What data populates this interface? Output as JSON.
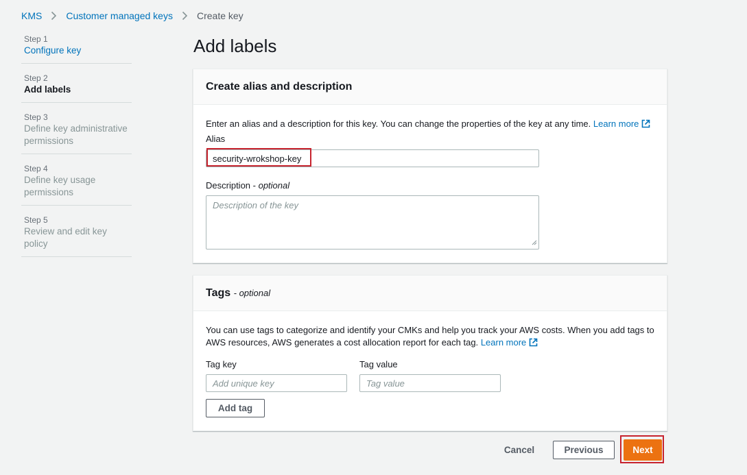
{
  "breadcrumb": {
    "items": [
      "KMS",
      "Customer managed keys"
    ],
    "current": "Create key"
  },
  "steps": [
    {
      "num": "Step 1",
      "label": "Configure key",
      "state": "done"
    },
    {
      "num": "Step 2",
      "label": "Add labels",
      "state": "active"
    },
    {
      "num": "Step 3",
      "label": "Define key administrative permissions",
      "state": "pending"
    },
    {
      "num": "Step 4",
      "label": "Define key usage permissions",
      "state": "pending"
    },
    {
      "num": "Step 5",
      "label": "Review and edit key policy",
      "state": "pending"
    }
  ],
  "page_title": "Add labels",
  "alias_panel": {
    "title": "Create alias and description",
    "intro": "Enter an alias and a description for this key. You can change the properties of the key at any time.",
    "learn_more": "Learn more",
    "alias_label": "Alias",
    "alias_value": "security-wrokshop-key",
    "description_label": "Description",
    "description_optional": "optional",
    "description_placeholder": "Description of the key"
  },
  "tags_panel": {
    "title": "Tags",
    "optional": "optional",
    "intro_line1": "You can use tags to categorize and identify your CMKs and help you track your AWS costs. When you add tags to",
    "intro_line2": "AWS resources, AWS generates a cost allocation report for each tag.",
    "learn_more": "Learn more",
    "tag_key_label": "Tag key",
    "tag_key_placeholder": "Add unique key",
    "tag_value_label": "Tag value",
    "tag_value_placeholder": "Tag value",
    "add_tag": "Add tag"
  },
  "footer": {
    "cancel": "Cancel",
    "previous": "Previous",
    "next": "Next"
  },
  "colors": {
    "link": "#0073bb",
    "primary": "#ec7211",
    "highlight": "#c7232e",
    "background": "#f2f3f3"
  }
}
